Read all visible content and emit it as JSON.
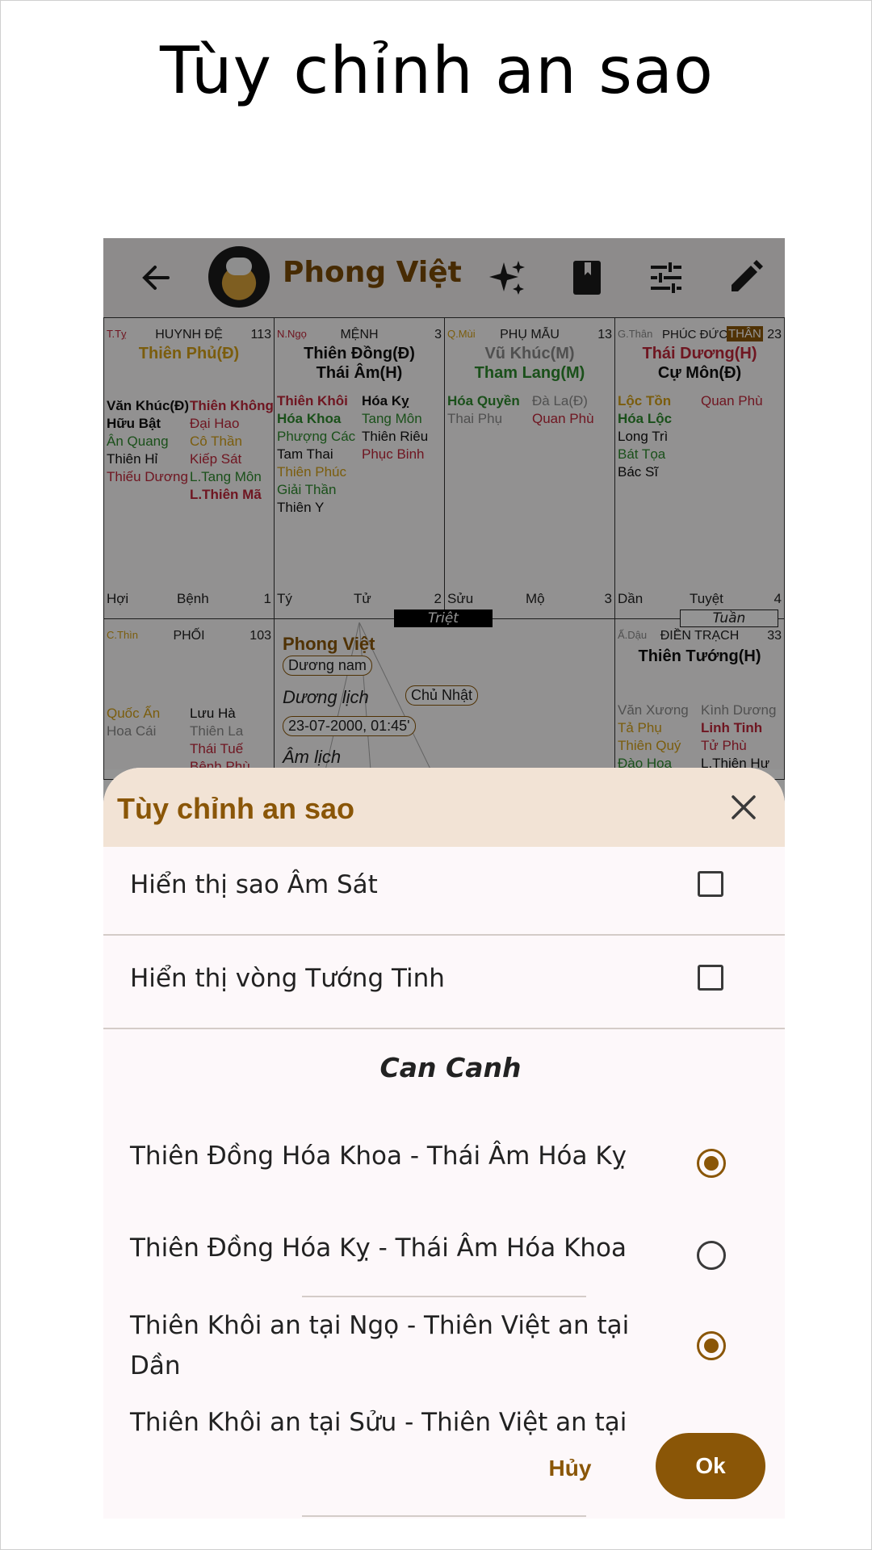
{
  "page_title": "Tùy chỉnh an sao",
  "app_bar": {
    "profile_name": "Phong Việt",
    "icons": [
      "back-arrow-icon",
      "sparkle-icon",
      "book-icon",
      "tune-icon",
      "edit-pencil-icon"
    ]
  },
  "chart": {
    "cells": [
      {
        "branch": "T.Tỵ",
        "palace": "HUYNH ĐỆ",
        "number": "113",
        "main_stars": [
          "Thiên Phủ(Đ)"
        ],
        "left_stars": [
          "Văn Khúc(Đ)",
          "Hữu Bật",
          "Ân Quang",
          "Thiên Hỉ",
          "Thiếu Dương"
        ],
        "right_stars": [
          "Thiên Không",
          "Đại Hao",
          "Cô Thần",
          "Kiếp Sát",
          "L.Tang Môn",
          "L.Thiên Mã"
        ],
        "footer_left": "Hợi",
        "footer_mid": "Bệnh",
        "footer_right": "1"
      },
      {
        "branch": "N.Ngọ",
        "palace": "MỆNH",
        "number": "3",
        "main_stars": [
          "Thiên Đồng(Đ)",
          "Thái Âm(H)"
        ],
        "left_stars": [
          "Thiên Khôi",
          "Hóa Khoa",
          "Phượng Các",
          "Tam Thai",
          "Thiên Phúc",
          "Giải Thần",
          "Thiên Y"
        ],
        "right_stars": [
          "Hóa Kỵ",
          "Tang Môn",
          "Thiên Riêu",
          "Phục Binh"
        ],
        "footer_left": "Tý",
        "footer_mid": "Tử",
        "footer_right": "2"
      },
      {
        "branch": "Q.Mùi",
        "palace": "PHỤ MẪU",
        "number": "13",
        "main_stars": [
          "Vũ Khúc(M)",
          "Tham Lang(M)"
        ],
        "left_stars": [
          "Hóa Quyền",
          "Thai Phụ"
        ],
        "right_stars": [
          "Đà La(Đ)",
          "Quan Phù"
        ],
        "footer_left": "Sửu",
        "footer_mid": "Mộ",
        "footer_right": "3"
      },
      {
        "branch": "G.Thân",
        "palace": "PHÚC ĐỨC",
        "badge": "THÂN",
        "number": "23",
        "main_stars": [
          "Thái Dương(H)",
          "Cự Môn(Đ)"
        ],
        "left_stars": [
          "Lộc Tồn",
          "Hóa Lộc",
          "Long Trì",
          "Bát Tọa",
          "Bác Sĩ"
        ],
        "right_stars": [
          "Quan Phù"
        ],
        "footer_left": "Dần",
        "footer_mid": "Tuyệt",
        "footer_right": "4"
      },
      {
        "branch": "C.Thìn",
        "palace": "PHỐI",
        "number": "103",
        "left_stars": [
          "Quốc Ấn",
          "Hoa Cái"
        ],
        "right_stars": [
          "Lưu Hà",
          "Thiên La",
          "Thái Tuế",
          "Bệnh Phù"
        ]
      },
      {
        "branch": "Ấ.Dậu",
        "palace": "ĐIỀN TRẠCH",
        "number": "33",
        "main_stars": [
          "Thiên Tướng(H)"
        ],
        "left_stars": [
          "Văn Xương",
          "Tả Phụ",
          "Thiên Quý",
          "Đào Hoa"
        ],
        "right_stars": [
          "Kình Dương",
          "Linh Tinh",
          "Tử Phù",
          "L.Thiên Hư"
        ]
      }
    ],
    "center": {
      "name": "Phong Việt",
      "gender_tag": "Dương nam",
      "solar_label": "Dương lịch",
      "weekday_tag": "Chủ Nhật",
      "datetime_tag": "23-07-2000, 01:45'",
      "lunar_label": "Âm lịch"
    },
    "triet_label": "Triệt",
    "tuan_label": "Tuần"
  },
  "sheet": {
    "title": "Tùy chỉnh an sao",
    "options": [
      {
        "label": "Hiển thị sao Âm Sát",
        "checked": false
      },
      {
        "label": "Hiển thị vòng Tướng Tinh",
        "checked": false
      }
    ],
    "section_title": "Can Canh",
    "radio_group_1": [
      {
        "label": "Thiên Đồng Hóa Khoa - Thái Âm Hóa Kỵ",
        "selected": true
      },
      {
        "label": "Thiên Đồng Hóa Kỵ - Thái Âm Hóa Khoa",
        "selected": false
      }
    ],
    "radio_group_2": [
      {
        "label": "Thiên Khôi an tại Ngọ - Thiên Việt an tại Dần",
        "selected": true
      },
      {
        "label": "Thiên Khôi an tại Sửu - Thiên Việt an tại",
        "selected": false
      }
    ],
    "cancel_label": "Hủy",
    "ok_label": "Ok"
  },
  "colors": {
    "accent": "#8a5607",
    "sheet_header_bg": "#f2e3d5",
    "sheet_bg": "#fdf8fa"
  }
}
